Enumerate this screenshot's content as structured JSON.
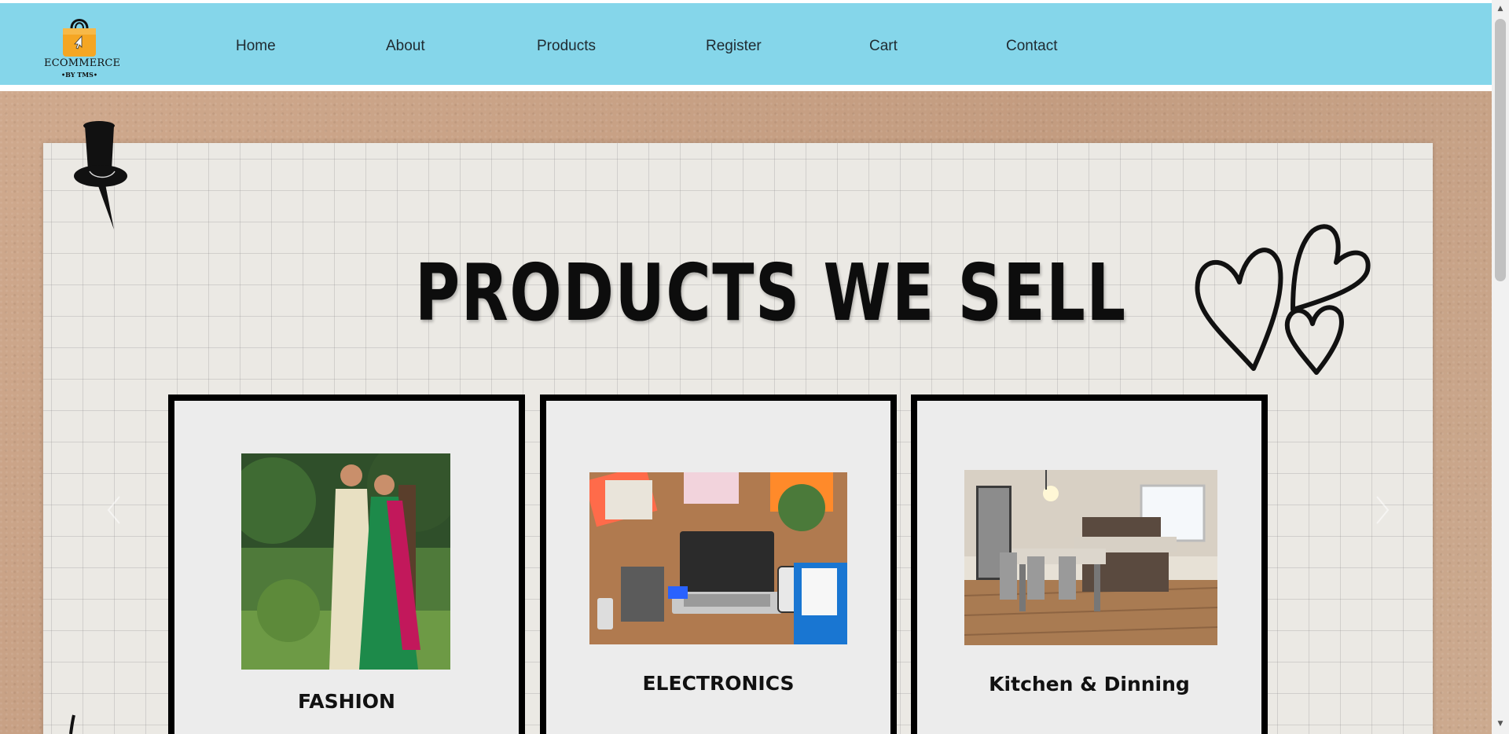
{
  "brand": {
    "name": "ECOMMERCE",
    "tagline": "•BY TMS•",
    "logo_icon": "shopping-bag-icon",
    "bag_color": "#f5a623"
  },
  "nav": {
    "links": [
      {
        "label": "Home"
      },
      {
        "label": "About"
      },
      {
        "label": "Products"
      },
      {
        "label": "Register"
      },
      {
        "label": "Cart"
      },
      {
        "label": "Contact"
      }
    ],
    "background_color": "#85d6ea"
  },
  "hero": {
    "title": "PRODUCTS WE SELL",
    "decorations": [
      "pushpin-icon",
      "hearts-doodle-icon"
    ],
    "prev_icon": "chevron-left-icon",
    "next_icon": "chevron-right-icon"
  },
  "products": [
    {
      "label": "FASHION",
      "image": "couple-in-traditional-wear-photo"
    },
    {
      "label": "ELECTRONICS",
      "image": "laptop-and-gadgets-desk-photo"
    },
    {
      "label": "Kitchen & Dinning",
      "image": "dining-room-kitchen-photo"
    }
  ],
  "scrollbar": {
    "up_icon": "arrow-up-icon",
    "down_icon": "arrow-down-icon",
    "up_glyph": "▲",
    "down_glyph": "▼"
  }
}
